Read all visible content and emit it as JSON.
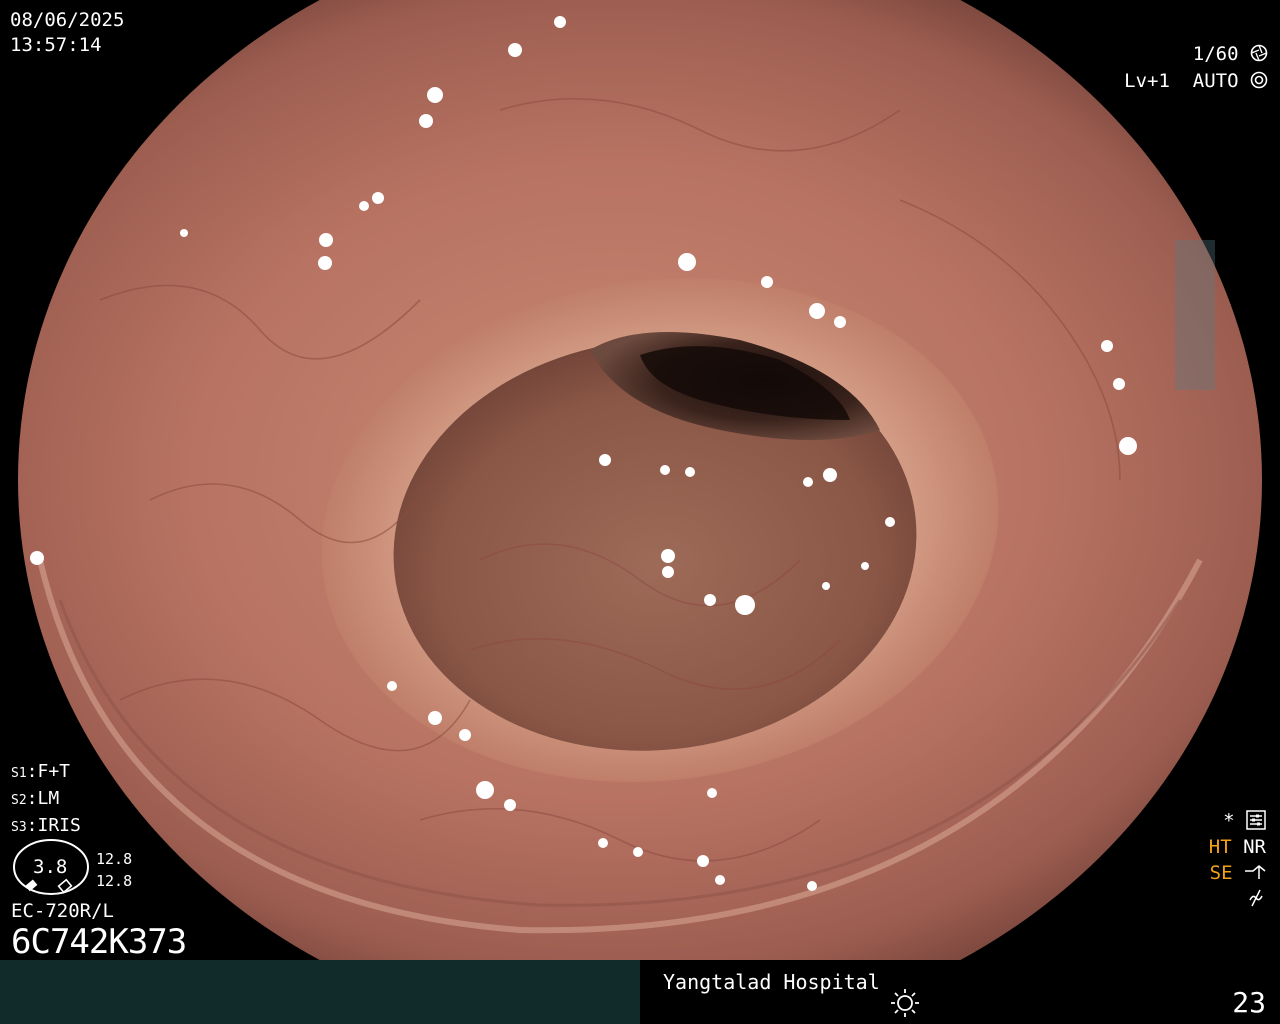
{
  "header": {
    "date": "08/06/2025",
    "time": "13:57:14"
  },
  "camera": {
    "shutter": "1/60",
    "level": "Lv+1",
    "exposure_mode": "AUTO"
  },
  "settings": [
    {
      "key": "S1",
      "value": "F+T"
    },
    {
      "key": "S2",
      "value": "LM"
    },
    {
      "key": "S3",
      "value": "IRIS"
    }
  ],
  "gauge": {
    "value": "3.8",
    "side_top": "12.8",
    "side_bottom": "12.8"
  },
  "scope": {
    "model": "EC-720R/L",
    "serial": "6C742K373"
  },
  "indicators": {
    "star": "*",
    "ht": "HT",
    "nr": "NR",
    "se": "SE"
  },
  "footer": {
    "hospital": "Yangtalad Hospital",
    "page_number": "23"
  },
  "colors": {
    "highlight": "#f2a21a",
    "footer_bar": "#112a2a",
    "mucosa": "#b26e60"
  },
  "icons": [
    "shutter-icon",
    "auto-iris-icon",
    "settings-icon",
    "curve-icon",
    "no-freq-icon",
    "light-icon"
  ]
}
